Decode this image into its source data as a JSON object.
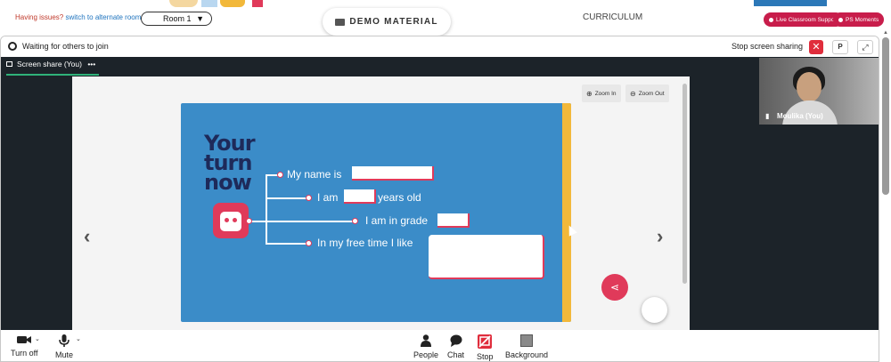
{
  "top": {
    "issue_text": "Having issues?",
    "issue_link": "switch to alternate room",
    "room_label": "Room 1",
    "room_caret": "▼",
    "demo_label": "DEMO MATERIAL",
    "curriculum_label": "CURRICULUM",
    "live_support_label": "Live Classroom Support",
    "ps_moments_label": "PS Moments",
    "accent_red": "#c81d4b",
    "accent_blue": "#2c78b8"
  },
  "meeting": {
    "waiting_text": "Waiting for others to join",
    "stop_sharing_label": "Stop screen sharing",
    "close_glyph": "✕",
    "p_button_label": "P",
    "expand_glyph": "⤢",
    "tab_label": "Screen share (You)",
    "tab_more": "•••"
  },
  "viewer": {
    "zoom_in_label": "Zoom In",
    "zoom_out_label": "Zoom Out",
    "prev_glyph": "‹",
    "next_glyph": "›",
    "share_glyph": "⋖"
  },
  "slide": {
    "heading_line1": "Your",
    "heading_line2": "turn",
    "heading_line3": "now",
    "line1": "My name is",
    "line2_a": "I am",
    "line2_b": "years old",
    "line3": "I am in grade",
    "line4": "In my free time I like",
    "background": "#3b8cc8",
    "accent": "#e03a5a",
    "band": "#f2b83a"
  },
  "participant": {
    "name": "Moulika (You)"
  },
  "toolbar": {
    "camera_label": "Turn off",
    "mic_label": "Mute",
    "people_label": "People",
    "chat_label": "Chat",
    "stop_label": "Stop",
    "background_label": "Background"
  }
}
